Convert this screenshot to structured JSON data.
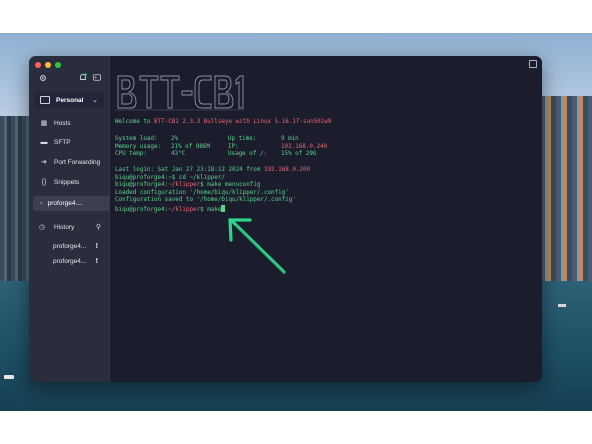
{
  "app": {
    "window_buttons": [
      "close",
      "minimize",
      "zoom"
    ],
    "top_icons": [
      "settings-icon",
      "notification-icon",
      "terminal-icon"
    ]
  },
  "sidebar": {
    "vault_label": "Personal",
    "nav": [
      {
        "icon": "hosts-icon",
        "label": "Hosts"
      },
      {
        "icon": "folder-icon",
        "label": "SFTP"
      },
      {
        "icon": "arrow-icon",
        "label": "Port Forwarding"
      },
      {
        "icon": "braces-icon",
        "label": "Snippets"
      }
    ],
    "active_session": "proforge4....",
    "history_label": "History",
    "history_items": [
      {
        "label": "proforge4...",
        "badge": "!"
      },
      {
        "label": "proforge4...",
        "badge": "!"
      }
    ]
  },
  "terminal": {
    "welcome": {
      "prefix": "Welcome to ",
      "name": "BTT-CB1 2.3.3 Bullseye with Linux 5.16.17-sun50iw9"
    },
    "stats": [
      {
        "k1": "System load:",
        "v1": "2%",
        "k2": "Up time:",
        "v2": "9 min"
      },
      {
        "k1": "Memory usage:",
        "v1": "21% of 986M",
        "k2": "IP:",
        "v2": "192.168.0.240"
      },
      {
        "k1": "CPU temp:",
        "v1": "43°C",
        "k2": "Usage of /:",
        "v2": "15% of 29G"
      }
    ],
    "last_login": {
      "text": "Last login: Sat Jan 27 23:18:12 2024 from ",
      "ip": "192.168.0.200"
    },
    "lines": [
      {
        "prompt": "biqu@proforge4:",
        "path": "~",
        "cmd": "$ cd ~/klipper/"
      },
      {
        "prompt": "biqu@proforge4:",
        "path": "~/klipper",
        "cmd": "$ make menuconfig"
      },
      {
        "plain": "Loaded configuration '/home/biqu/klipper/.config'"
      },
      {
        "plain": "Configuration saved to '/home/biqu/klipper/.config'"
      },
      {
        "prompt": "biqu@proforge4:",
        "path": "~/klipper",
        "cmd": "$ make"
      }
    ]
  },
  "colors": {
    "terminal_bg": "#1b1d2c",
    "sidebar_bg": "#2a2d3b",
    "green": "#5ad38a",
    "red": "#e46a73",
    "arrow": "#2fd38b"
  }
}
